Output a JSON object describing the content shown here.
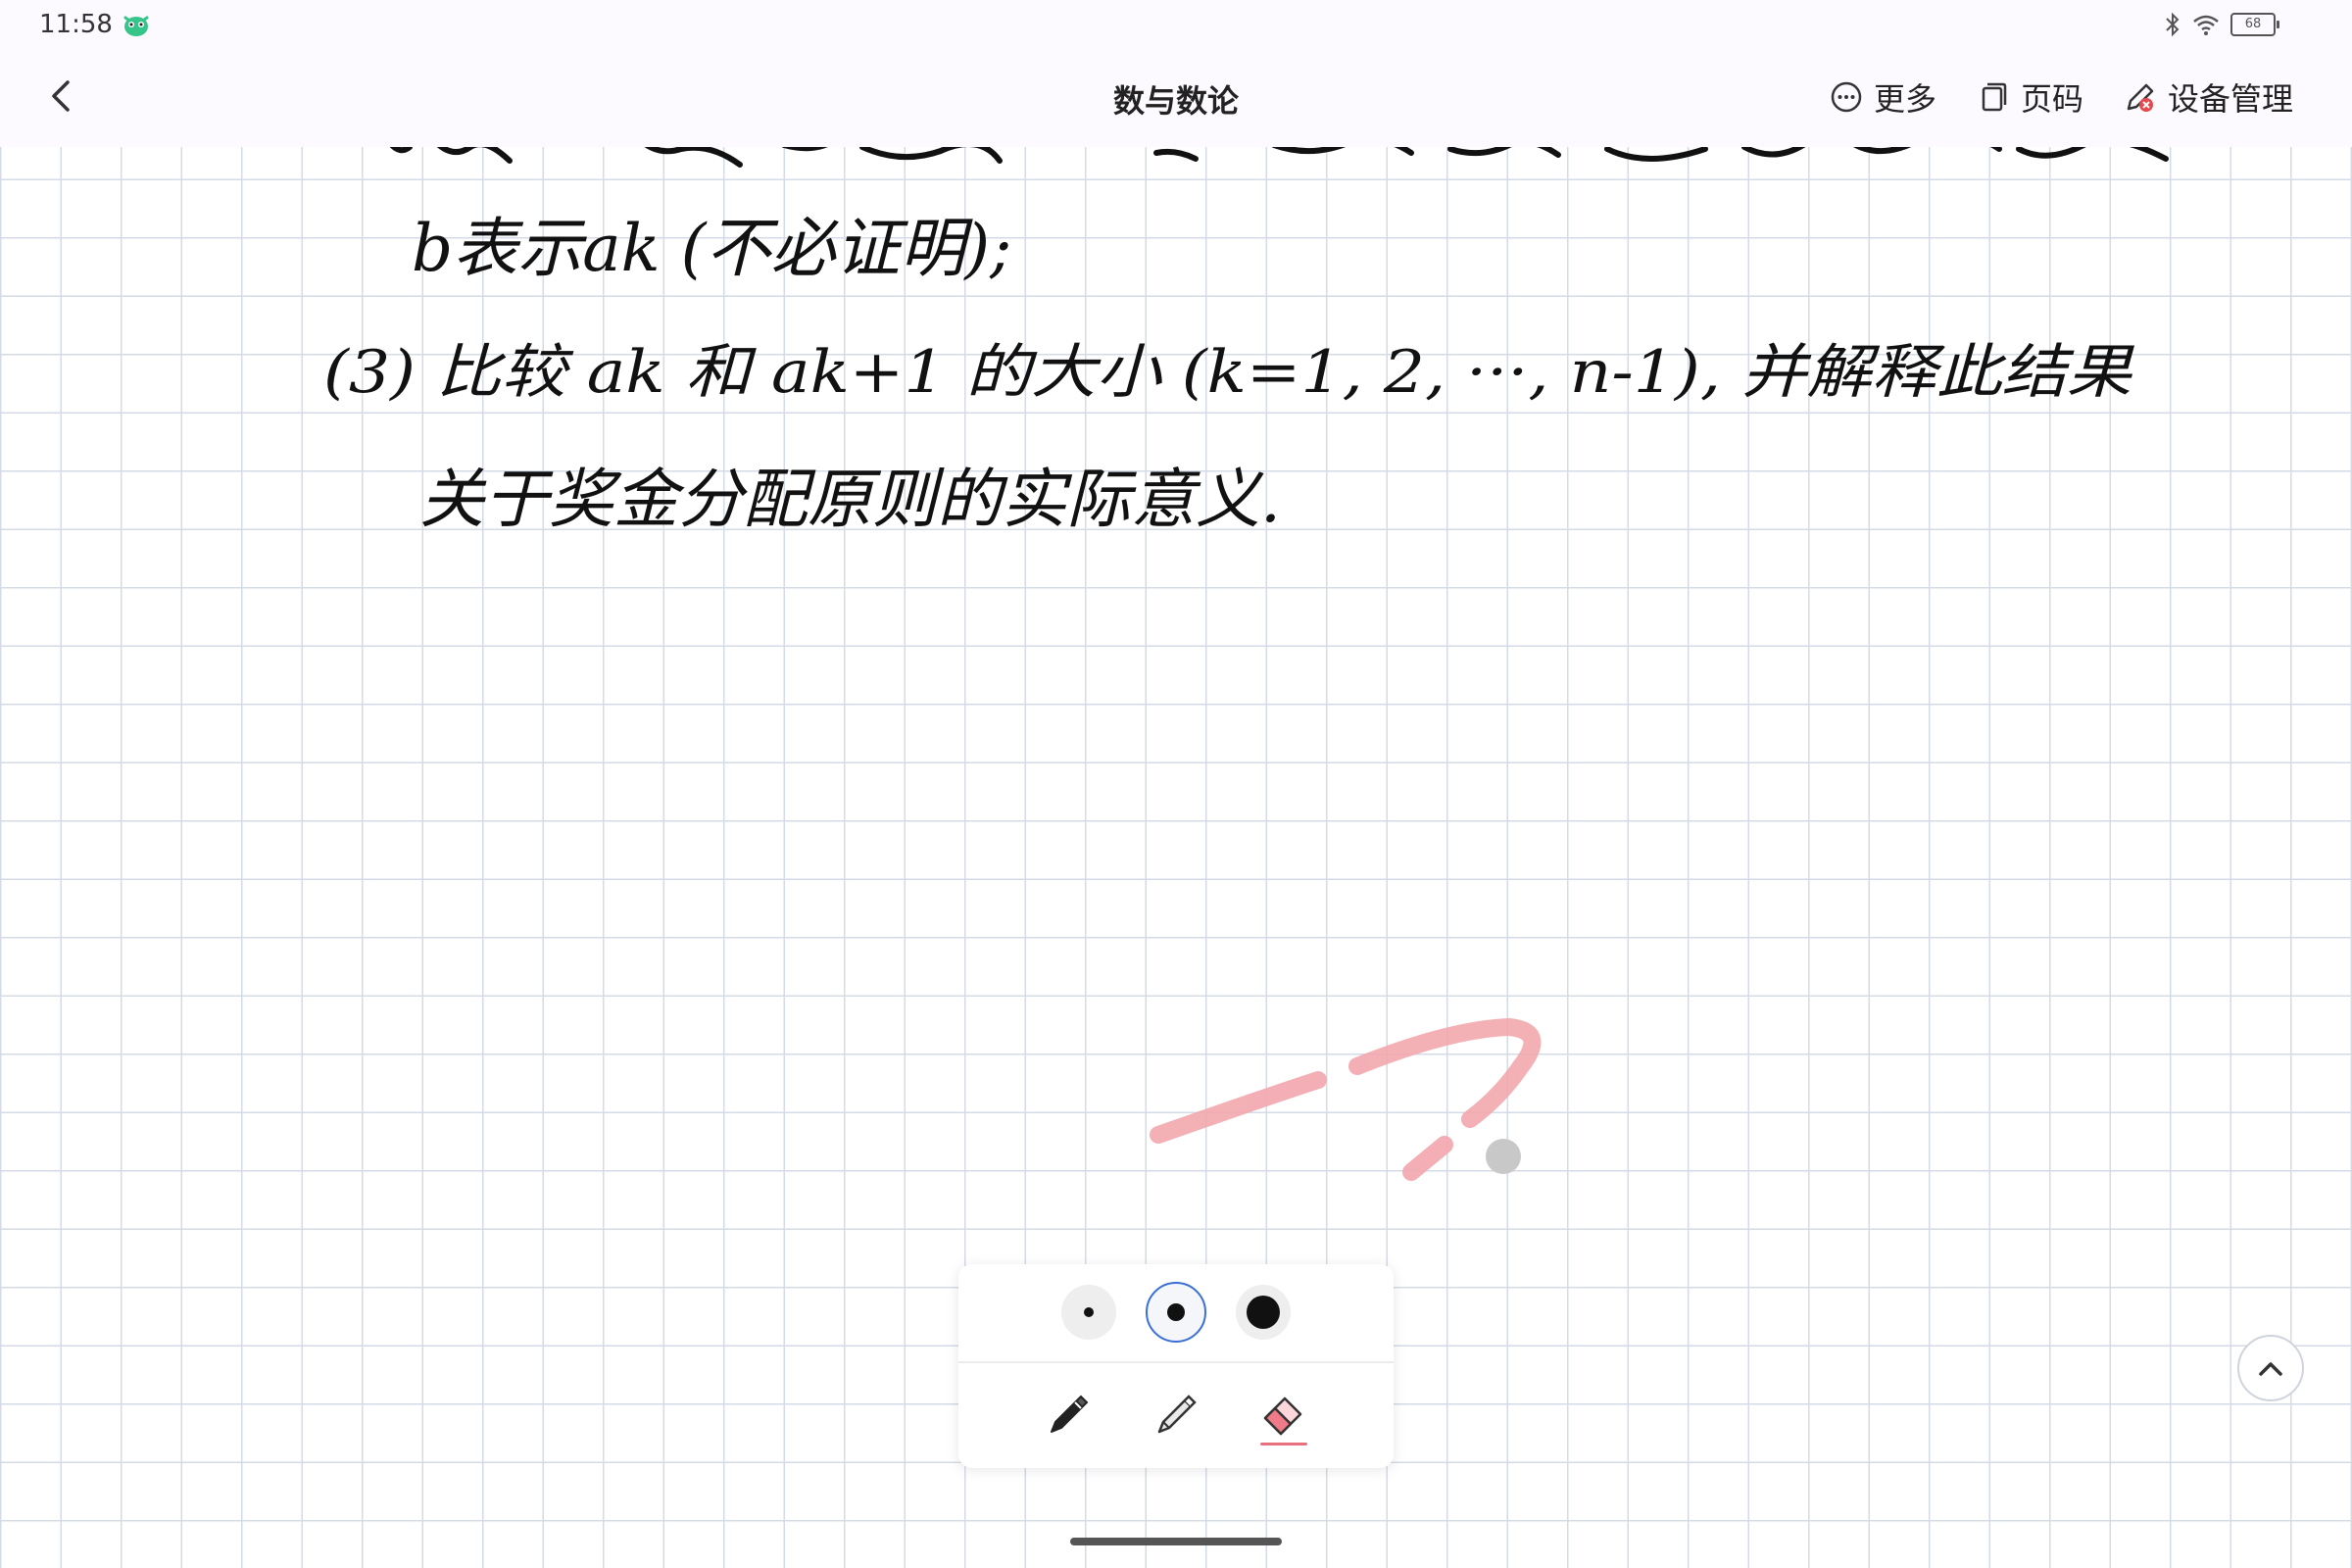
{
  "status_bar": {
    "time": "11:58",
    "battery": "68",
    "icons": [
      "bluetooth-icon",
      "wifi-icon",
      "battery-icon"
    ]
  },
  "header": {
    "title": "数与数论",
    "actions": [
      {
        "label": "更多",
        "icon": "more-icon"
      },
      {
        "label": "页码",
        "icon": "page-number-icon"
      },
      {
        "label": "设备管理",
        "icon": "device-manage-icon"
      }
    ]
  },
  "handwriting": {
    "line1": "b表示ak (不必证明);",
    "line2": "(3) 比较 ak 和 ak+1 的大小 (k=1, 2, ···, n-1), 并解释此结果",
    "line3": "关于奖金分配原则的实际意义."
  },
  "pen_palette": {
    "sizes": [
      "small",
      "medium",
      "large"
    ],
    "selected_size": "medium",
    "tools": [
      "pen",
      "pencil",
      "highlighter"
    ],
    "selected_tool": "highlighter",
    "accent": "#e86f7e"
  },
  "colors": {
    "stroke_ink": "#111111",
    "highlighter_stroke": "#f2a7ad",
    "grid": "#d5dbe6"
  }
}
